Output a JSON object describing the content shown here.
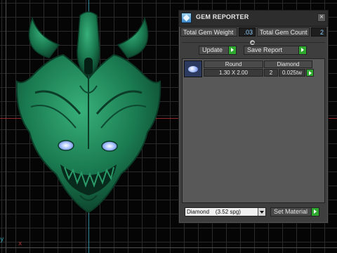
{
  "window": {
    "title": "GEM REPORTER",
    "close_glyph": "×",
    "icon": "gem-reporter-app-icon"
  },
  "stats": {
    "weight_label": "Total Gem Weight",
    "weight_value": ".03",
    "count_label": "Total Gem Count",
    "count_value": "2"
  },
  "toolbar": {
    "update_label": "Update",
    "save_label": "Save Report"
  },
  "gem_list": {
    "rows": [
      {
        "thumbnail": "round-gem-icon",
        "cut": "Round",
        "size": "1.30 X 2.00",
        "material": "Diamond",
        "count": "2",
        "weight": "0.025tw"
      }
    ]
  },
  "material": {
    "selected": "Diamond    (3.52 spg)",
    "set_label": "Set Material"
  },
  "viewport": {
    "corner_y_label": "y",
    "corner_x_label": "x"
  },
  "colors": {
    "model_green": "#1f8a5a",
    "axis_vertical": "#3aa7b6",
    "axis_horizontal": "#b23232",
    "go_button": "#2fa82f",
    "value_text": "#8fd0ff"
  }
}
